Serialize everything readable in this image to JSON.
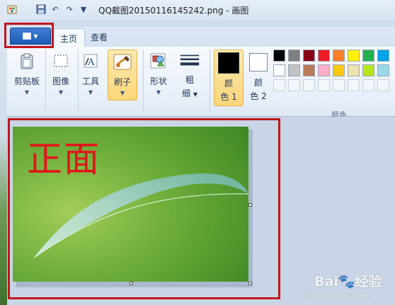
{
  "window": {
    "title": "QQ截图20150116145242.png - 画图"
  },
  "quick_access": {
    "icons": [
      "paint-app-icon",
      "save-icon",
      "undo-icon",
      "redo-icon",
      "customize-arrow-icon"
    ]
  },
  "tabs": {
    "home": "主页",
    "view": "查看"
  },
  "ribbon": {
    "clipboard": "剪贴板",
    "image": "图像",
    "tools": "工具",
    "brushes": "刷子",
    "shapes": "形状",
    "size_line1": "粗",
    "size_line2": "细",
    "color1_line1": "颜",
    "color1_line2": "色 1",
    "color2_line1": "颜",
    "color2_line2": "色 2",
    "colors_group": "颜色"
  },
  "palette": {
    "row1": [
      "#000000",
      "#7f7f7f",
      "#880015",
      "#ed1c24",
      "#ff7f27",
      "#fff200",
      "#22b14c",
      "#00a2e8"
    ],
    "row2": [
      "#ffffff",
      "#c3c3c3",
      "#b97a57",
      "#ffaec9",
      "#ffc90e",
      "#efe4b0",
      "#b5e61d",
      "#99d9ea"
    ],
    "color1": "#000000",
    "color2": "#ffffff"
  },
  "canvas": {
    "text": "正面"
  },
  "highlight_color": "#c0161e",
  "watermark": {
    "logo": "Bai🐾经验",
    "url": "jingyan.baidu.com"
  }
}
